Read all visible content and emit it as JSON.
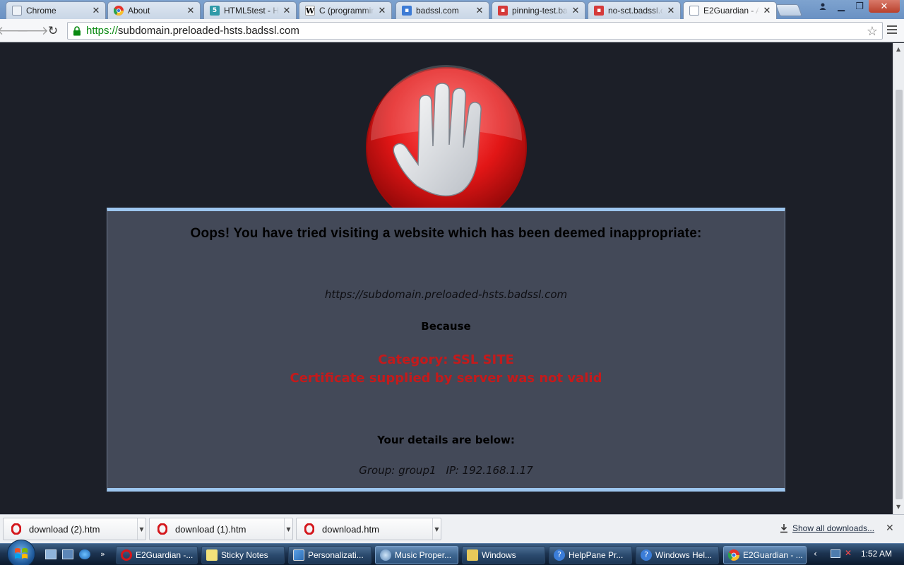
{
  "browser": {
    "tabs": [
      {
        "title": "Chrome",
        "icon": "document-icon"
      },
      {
        "title": "About",
        "icon": "chrome-icon"
      },
      {
        "title": "HTML5test - H",
        "icon": "html5-icon"
      },
      {
        "title": "C (programmin",
        "icon": "wikipedia-icon"
      },
      {
        "title": "badssl.com",
        "icon": "lock-icon"
      },
      {
        "title": "pinning-test.ba",
        "icon": "broken-lock-icon"
      },
      {
        "title": "no-sct.badssl.c",
        "icon": "broken-lock-icon"
      },
      {
        "title": "E2Guardian - A",
        "icon": "document-icon"
      }
    ],
    "url_scheme": "https://",
    "url_host": "subdomain.preloaded-hsts.badssl.com"
  },
  "page": {
    "headline": "Oops! You have tried visiting a website which has been deemed inappropriate:",
    "blocked_url": "https://subdomain.preloaded-hsts.badssl.com",
    "because_label": "Because",
    "category": "Category: SSL SITE",
    "reason": "Certificate supplied by server was not valid",
    "details_title": "Your details are below:",
    "group": "Group: group1",
    "ip": "IP: 192.168.1.17"
  },
  "downloads": {
    "items": [
      {
        "name": "download (2).htm"
      },
      {
        "name": "download (1).htm"
      },
      {
        "name": "download.htm"
      }
    ],
    "show_all": "Show all downloads..."
  },
  "taskbar": {
    "tasks": [
      {
        "title": "E2Guardian -...",
        "icon": "opera-icon"
      },
      {
        "title": "Sticky Notes",
        "icon": "sticky-notes-icon"
      },
      {
        "title": "Personalizati...",
        "icon": "personalization-icon"
      },
      {
        "title": "Music Proper...",
        "icon": "music-icon"
      },
      {
        "title": "Windows",
        "icon": "folder-icon"
      },
      {
        "title": "HelpPane Pr...",
        "icon": "help-icon"
      },
      {
        "title": "Windows Hel...",
        "icon": "help-icon"
      },
      {
        "title": "E2Guardian - ...",
        "icon": "chrome-icon"
      }
    ],
    "clock": "1:52 AM"
  },
  "colors": {
    "page_bg": "#1c1f28",
    "panel_bg": "#434958",
    "panel_border": "#9dc6ef",
    "reason_red": "#d31515",
    "url_green": "#0a8a12"
  }
}
